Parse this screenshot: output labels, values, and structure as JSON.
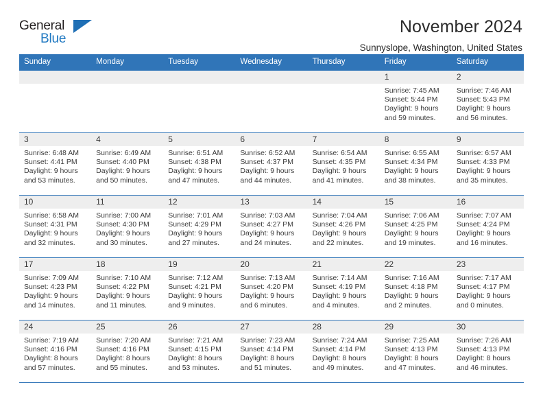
{
  "logo": {
    "word_general": "General",
    "word_blue": "Blue",
    "triangle": "blue-triangle-icon"
  },
  "header": {
    "title": "November 2024",
    "subtitle": "Sunnyslope, Washington, United States"
  },
  "calendar": {
    "weekday_headers": [
      "Sunday",
      "Monday",
      "Tuesday",
      "Wednesday",
      "Thursday",
      "Friday",
      "Saturday"
    ],
    "accent_color": "#3075b8",
    "daynum_background": "#eeeeee",
    "weeks": [
      [
        {
          "day": "",
          "sunrise": "",
          "sunset": "",
          "daylight_line1": "",
          "daylight_line2": ""
        },
        {
          "day": "",
          "sunrise": "",
          "sunset": "",
          "daylight_line1": "",
          "daylight_line2": ""
        },
        {
          "day": "",
          "sunrise": "",
          "sunset": "",
          "daylight_line1": "",
          "daylight_line2": ""
        },
        {
          "day": "",
          "sunrise": "",
          "sunset": "",
          "daylight_line1": "",
          "daylight_line2": ""
        },
        {
          "day": "",
          "sunrise": "",
          "sunset": "",
          "daylight_line1": "",
          "daylight_line2": ""
        },
        {
          "day": "1",
          "sunrise": "Sunrise: 7:45 AM",
          "sunset": "Sunset: 5:44 PM",
          "daylight_line1": "Daylight: 9 hours",
          "daylight_line2": "and 59 minutes."
        },
        {
          "day": "2",
          "sunrise": "Sunrise: 7:46 AM",
          "sunset": "Sunset: 5:43 PM",
          "daylight_line1": "Daylight: 9 hours",
          "daylight_line2": "and 56 minutes."
        }
      ],
      [
        {
          "day": "3",
          "sunrise": "Sunrise: 6:48 AM",
          "sunset": "Sunset: 4:41 PM",
          "daylight_line1": "Daylight: 9 hours",
          "daylight_line2": "and 53 minutes."
        },
        {
          "day": "4",
          "sunrise": "Sunrise: 6:49 AM",
          "sunset": "Sunset: 4:40 PM",
          "daylight_line1": "Daylight: 9 hours",
          "daylight_line2": "and 50 minutes."
        },
        {
          "day": "5",
          "sunrise": "Sunrise: 6:51 AM",
          "sunset": "Sunset: 4:38 PM",
          "daylight_line1": "Daylight: 9 hours",
          "daylight_line2": "and 47 minutes."
        },
        {
          "day": "6",
          "sunrise": "Sunrise: 6:52 AM",
          "sunset": "Sunset: 4:37 PM",
          "daylight_line1": "Daylight: 9 hours",
          "daylight_line2": "and 44 minutes."
        },
        {
          "day": "7",
          "sunrise": "Sunrise: 6:54 AM",
          "sunset": "Sunset: 4:35 PM",
          "daylight_line1": "Daylight: 9 hours",
          "daylight_line2": "and 41 minutes."
        },
        {
          "day": "8",
          "sunrise": "Sunrise: 6:55 AM",
          "sunset": "Sunset: 4:34 PM",
          "daylight_line1": "Daylight: 9 hours",
          "daylight_line2": "and 38 minutes."
        },
        {
          "day": "9",
          "sunrise": "Sunrise: 6:57 AM",
          "sunset": "Sunset: 4:33 PM",
          "daylight_line1": "Daylight: 9 hours",
          "daylight_line2": "and 35 minutes."
        }
      ],
      [
        {
          "day": "10",
          "sunrise": "Sunrise: 6:58 AM",
          "sunset": "Sunset: 4:31 PM",
          "daylight_line1": "Daylight: 9 hours",
          "daylight_line2": "and 32 minutes."
        },
        {
          "day": "11",
          "sunrise": "Sunrise: 7:00 AM",
          "sunset": "Sunset: 4:30 PM",
          "daylight_line1": "Daylight: 9 hours",
          "daylight_line2": "and 30 minutes."
        },
        {
          "day": "12",
          "sunrise": "Sunrise: 7:01 AM",
          "sunset": "Sunset: 4:29 PM",
          "daylight_line1": "Daylight: 9 hours",
          "daylight_line2": "and 27 minutes."
        },
        {
          "day": "13",
          "sunrise": "Sunrise: 7:03 AM",
          "sunset": "Sunset: 4:27 PM",
          "daylight_line1": "Daylight: 9 hours",
          "daylight_line2": "and 24 minutes."
        },
        {
          "day": "14",
          "sunrise": "Sunrise: 7:04 AM",
          "sunset": "Sunset: 4:26 PM",
          "daylight_line1": "Daylight: 9 hours",
          "daylight_line2": "and 22 minutes."
        },
        {
          "day": "15",
          "sunrise": "Sunrise: 7:06 AM",
          "sunset": "Sunset: 4:25 PM",
          "daylight_line1": "Daylight: 9 hours",
          "daylight_line2": "and 19 minutes."
        },
        {
          "day": "16",
          "sunrise": "Sunrise: 7:07 AM",
          "sunset": "Sunset: 4:24 PM",
          "daylight_line1": "Daylight: 9 hours",
          "daylight_line2": "and 16 minutes."
        }
      ],
      [
        {
          "day": "17",
          "sunrise": "Sunrise: 7:09 AM",
          "sunset": "Sunset: 4:23 PM",
          "daylight_line1": "Daylight: 9 hours",
          "daylight_line2": "and 14 minutes."
        },
        {
          "day": "18",
          "sunrise": "Sunrise: 7:10 AM",
          "sunset": "Sunset: 4:22 PM",
          "daylight_line1": "Daylight: 9 hours",
          "daylight_line2": "and 11 minutes."
        },
        {
          "day": "19",
          "sunrise": "Sunrise: 7:12 AM",
          "sunset": "Sunset: 4:21 PM",
          "daylight_line1": "Daylight: 9 hours",
          "daylight_line2": "and 9 minutes."
        },
        {
          "day": "20",
          "sunrise": "Sunrise: 7:13 AM",
          "sunset": "Sunset: 4:20 PM",
          "daylight_line1": "Daylight: 9 hours",
          "daylight_line2": "and 6 minutes."
        },
        {
          "day": "21",
          "sunrise": "Sunrise: 7:14 AM",
          "sunset": "Sunset: 4:19 PM",
          "daylight_line1": "Daylight: 9 hours",
          "daylight_line2": "and 4 minutes."
        },
        {
          "day": "22",
          "sunrise": "Sunrise: 7:16 AM",
          "sunset": "Sunset: 4:18 PM",
          "daylight_line1": "Daylight: 9 hours",
          "daylight_line2": "and 2 minutes."
        },
        {
          "day": "23",
          "sunrise": "Sunrise: 7:17 AM",
          "sunset": "Sunset: 4:17 PM",
          "daylight_line1": "Daylight: 9 hours",
          "daylight_line2": "and 0 minutes."
        }
      ],
      [
        {
          "day": "24",
          "sunrise": "Sunrise: 7:19 AM",
          "sunset": "Sunset: 4:16 PM",
          "daylight_line1": "Daylight: 8 hours",
          "daylight_line2": "and 57 minutes."
        },
        {
          "day": "25",
          "sunrise": "Sunrise: 7:20 AM",
          "sunset": "Sunset: 4:16 PM",
          "daylight_line1": "Daylight: 8 hours",
          "daylight_line2": "and 55 minutes."
        },
        {
          "day": "26",
          "sunrise": "Sunrise: 7:21 AM",
          "sunset": "Sunset: 4:15 PM",
          "daylight_line1": "Daylight: 8 hours",
          "daylight_line2": "and 53 minutes."
        },
        {
          "day": "27",
          "sunrise": "Sunrise: 7:23 AM",
          "sunset": "Sunset: 4:14 PM",
          "daylight_line1": "Daylight: 8 hours",
          "daylight_line2": "and 51 minutes."
        },
        {
          "day": "28",
          "sunrise": "Sunrise: 7:24 AM",
          "sunset": "Sunset: 4:14 PM",
          "daylight_line1": "Daylight: 8 hours",
          "daylight_line2": "and 49 minutes."
        },
        {
          "day": "29",
          "sunrise": "Sunrise: 7:25 AM",
          "sunset": "Sunset: 4:13 PM",
          "daylight_line1": "Daylight: 8 hours",
          "daylight_line2": "and 47 minutes."
        },
        {
          "day": "30",
          "sunrise": "Sunrise: 7:26 AM",
          "sunset": "Sunset: 4:13 PM",
          "daylight_line1": "Daylight: 8 hours",
          "daylight_line2": "and 46 minutes."
        }
      ]
    ]
  }
}
